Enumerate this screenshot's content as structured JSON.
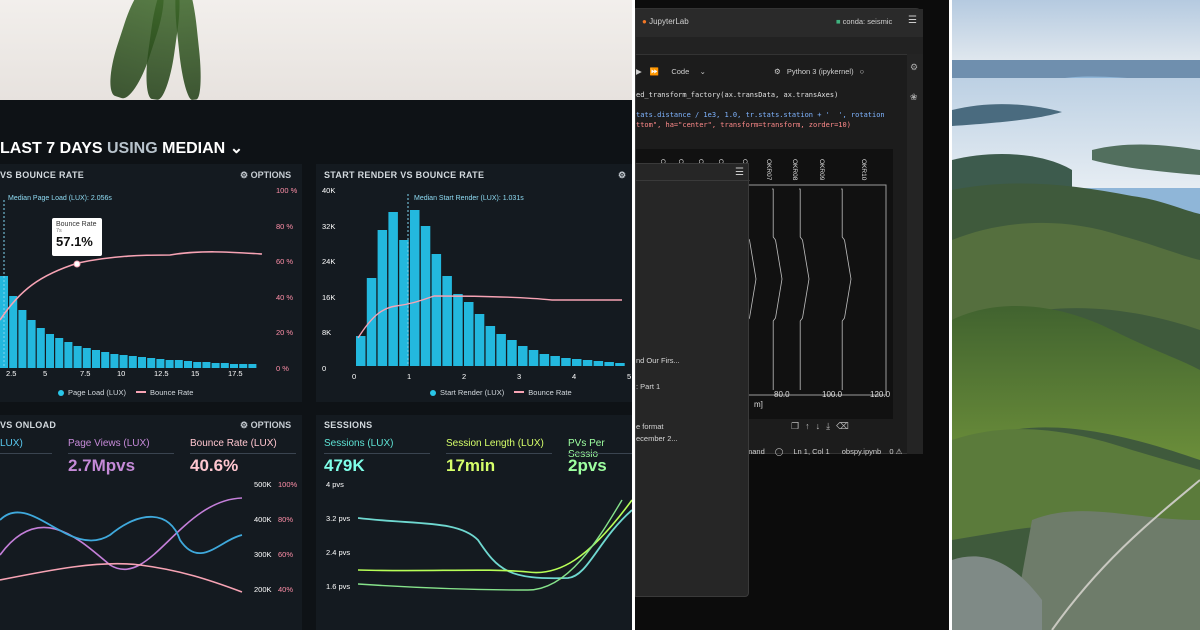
{
  "dashboard": {
    "title_prefix": "LAST 7 DAYS USING",
    "title_accent": "7 DAYS",
    "title_using": "USING",
    "title_metric": "MEDIAN",
    "chart1": {
      "heading": "VS BOUNCE RATE",
      "options": "OPTIONS",
      "median_label": "Median Page Load (LUX): 2.056s",
      "tooltip": {
        "title": "Bounce Rate",
        "sub": "7s",
        "value": "57.1%"
      },
      "y_right": [
        "100 %",
        "80 %",
        "60 %",
        "40 %",
        "20 %",
        "0 %"
      ],
      "x_ticks": [
        "2.5",
        "5",
        "7.5",
        "10",
        "12.5",
        "15",
        "17.5"
      ],
      "legend_bar": "Page Load (LUX)",
      "legend_line": "Bounce Rate"
    },
    "chart2": {
      "heading": "START RENDER VS BOUNCE RATE",
      "median_label": "Median Start Render (LUX): 1.031s",
      "y_left": [
        "40K",
        "32K",
        "24K",
        "16K",
        "8K",
        "0"
      ],
      "x_ticks": [
        "0",
        "1",
        "2",
        "3",
        "4",
        "5"
      ],
      "legend_bar": "Start Render (LUX)",
      "legend_line": "Bounce Rate"
    },
    "card3": {
      "heading": "VS ONLOAD",
      "options": "OPTIONS",
      "m1_label": "LUX)",
      "m2_label": "Page Views (LUX)",
      "m2_value": "2.7Mpvs",
      "m3_label": "Bounce Rate (LUX)",
      "m3_value": "40.6%",
      "y_left": [
        "500K",
        "400K",
        "300K",
        "200K"
      ],
      "y_right": [
        "100%",
        "80%",
        "60%",
        "40%"
      ]
    },
    "card4": {
      "heading": "SESSIONS",
      "m1_label": "Sessions (LUX)",
      "m1_value": "479K",
      "m2_label": "Session Length (LUX)",
      "m2_value": "17min",
      "m3_label": "PVs Per Sessio",
      "m3_value": "2pvs",
      "y_left": [
        "4 pvs",
        "3.2 pvs",
        "2.4 pvs",
        "1.6 pvs"
      ]
    }
  },
  "jupyter": {
    "app_title": "JupyterLab",
    "env": "conda: seismic",
    "cell_type": "Code",
    "kernel": "Python 3 (ipykernel)",
    "code_lines": [
      "ed_transform_factory(ax.transData, ax.transAxes)",
      "",
      "tats.distance / 1e3, 1.0, tr.stats.station + '  ', rotation",
      "ttom\", ha=\"center\", transform=transform, zorder=10)"
    ],
    "traces": [
      "OKR",
      "OKR",
      "OKR",
      "OKR",
      "OKR",
      "OKR07",
      "OKR08",
      "OKR09",
      "OKR10"
    ],
    "x_ticks": [
      "80.0",
      "100.0",
      "120.0"
    ],
    "x_unit": "m]",
    "file_items": [
      "nd Our Firs...",
      ": Part 1",
      "e format",
      "ecember 2..."
    ],
    "status_mode": "mand",
    "status_pos": "Ln 1, Col 1",
    "status_file": "obspy.ipynb",
    "status_count": "0"
  }
}
